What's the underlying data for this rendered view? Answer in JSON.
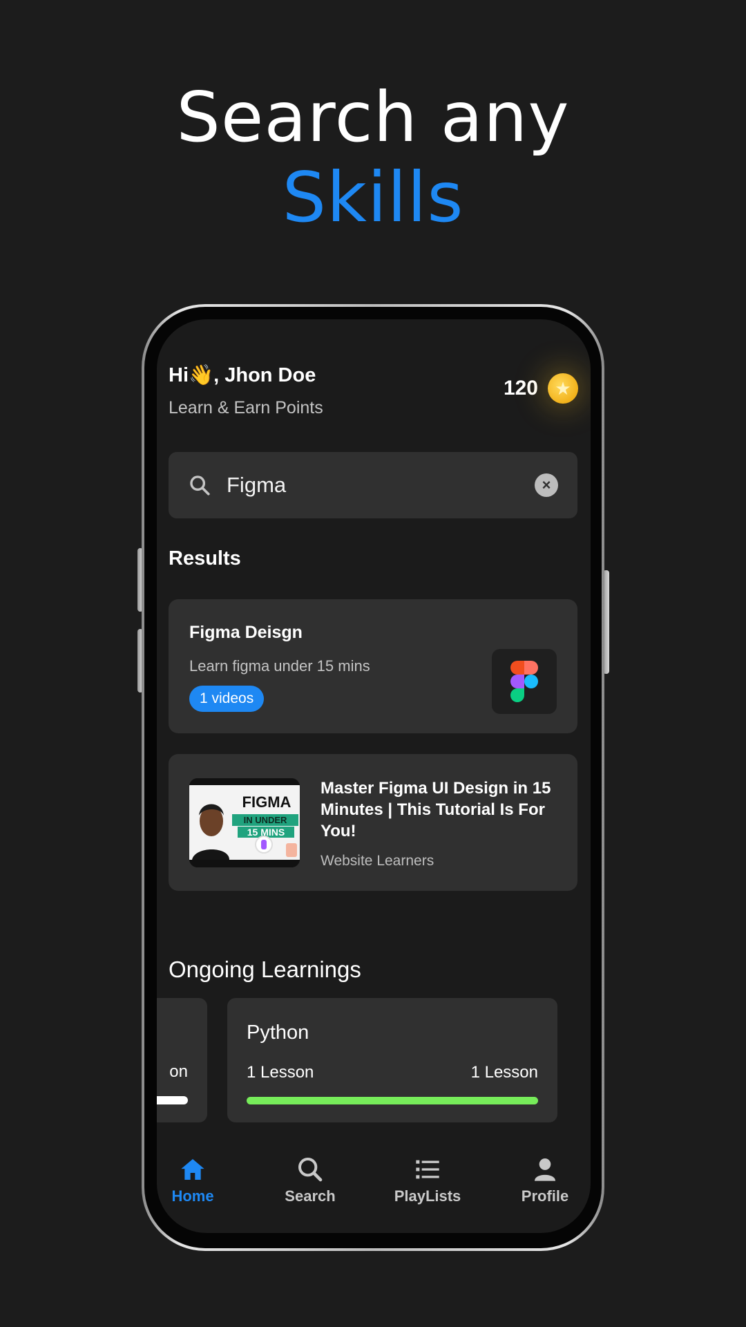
{
  "headline": {
    "line1": "Search any",
    "line2": "Skills"
  },
  "colors": {
    "accent": "#1e88f3",
    "background": "#1c1c1c",
    "card": "#303030",
    "progress": "#77ec5a",
    "coin": "#f2b21b"
  },
  "header": {
    "greeting": "Hi👋, Jhon Doe",
    "subtitle": "Learn & Earn Points",
    "points": "120",
    "points_icon": "star-coin-icon"
  },
  "search": {
    "value": "Figma",
    "icon": "search-icon",
    "clear_icon": "close-icon"
  },
  "results": {
    "title": "Results",
    "course": {
      "title": "Figma Deisgn",
      "subtitle": "Learn figma under 15 mins",
      "badge": "1 videos",
      "icon": "figma-logo-icon"
    },
    "video": {
      "title": "Master Figma UI Design in 15 Minutes | This Tutorial Is For You!",
      "author": "Website Learners",
      "thumbnail_text": {
        "line1": "FIGMA",
        "line2": "IN UNDER",
        "line3": "15 MINS"
      }
    }
  },
  "ongoing": {
    "title": "Ongoing Learnings",
    "cards": [
      {
        "partial_label": "on",
        "progress": 1.0
      },
      {
        "title": "Python",
        "left_label": "1 Lesson",
        "right_label": "1 Lesson",
        "progress": 1.0
      }
    ]
  },
  "nav": {
    "items": [
      {
        "label": "Home",
        "icon": "home-icon",
        "active": true
      },
      {
        "label": "Search",
        "icon": "search-icon",
        "active": false
      },
      {
        "label": "PlayLists",
        "icon": "playlist-icon",
        "active": false
      },
      {
        "label": "Profile",
        "icon": "profile-icon",
        "active": false
      }
    ]
  }
}
